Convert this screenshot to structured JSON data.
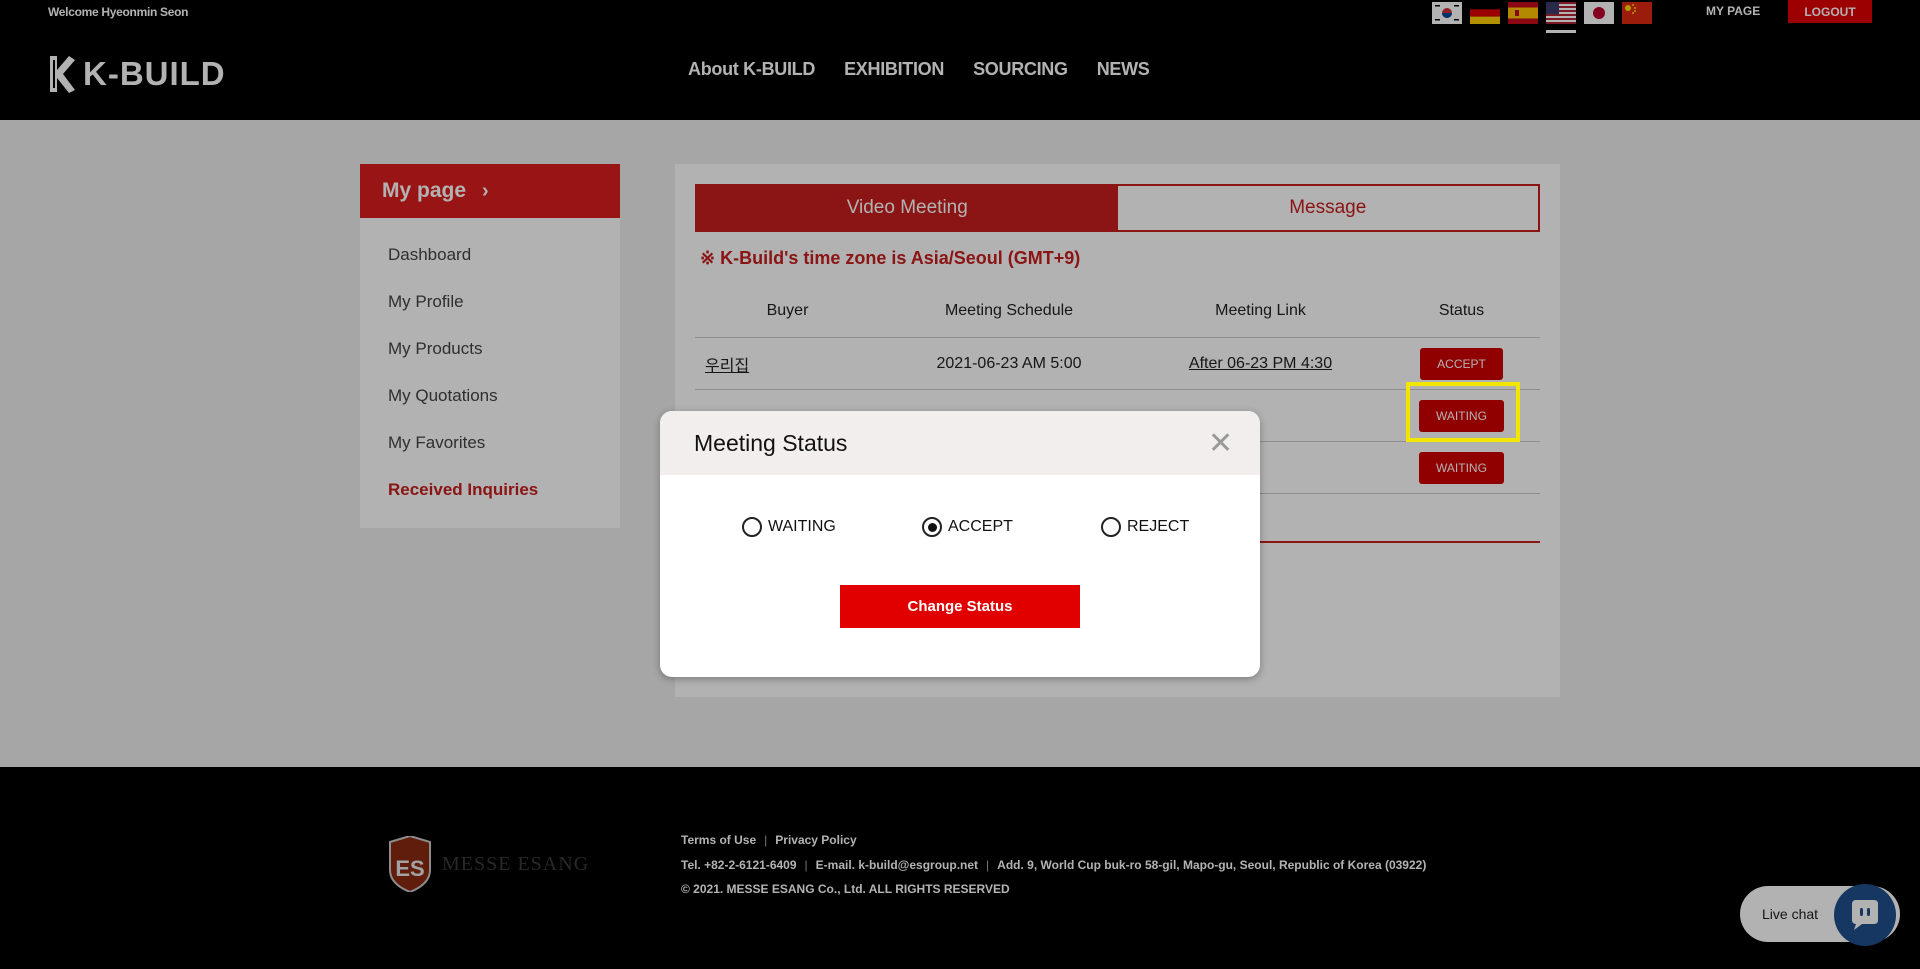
{
  "header": {
    "welcome": "Welcome Hyeonmin Seon",
    "logo_text": "K-BUILD",
    "nav": [
      "About K-BUILD",
      "EXHIBITION",
      "SOURCING",
      "NEWS"
    ],
    "my_page": "MY PAGE",
    "logout": "LOGOUT",
    "languages": [
      "korean-flag-icon",
      "german-flag-icon",
      "spanish-flag-icon",
      "us-flag-icon",
      "japanese-flag-icon",
      "chinese-flag-icon"
    ]
  },
  "sidebar": {
    "title": "My page",
    "items": [
      "Dashboard",
      "My Profile",
      "My Products",
      "My Quotations",
      "My Favorites",
      "Received Inquiries"
    ],
    "active": "Received Inquiries"
  },
  "main": {
    "tabs": [
      "Video Meeting",
      "Message"
    ],
    "active_tab": "Video Meeting",
    "timezone_note": "※ K-Build's time zone is Asia/Seoul (GMT+9)",
    "table": {
      "headers": [
        "Buyer",
        "Meeting Schedule",
        "Meeting Link",
        "Status"
      ],
      "rows": [
        {
          "buyer": "우리집",
          "schedule": "2021-06-23 AM 5:00",
          "link": "After 06-23 PM 4:30",
          "status": "ACCEPT"
        },
        {
          "buyer": "",
          "schedule": "",
          "link": "",
          "status": "WAITING"
        },
        {
          "buyer": "",
          "schedule": "",
          "link": "",
          "status": "WAITING"
        }
      ]
    }
  },
  "modal": {
    "title": "Meeting Status",
    "options": [
      "WAITING",
      "ACCEPT",
      "REJECT"
    ],
    "selected": "ACCEPT",
    "button": "Change Status"
  },
  "footer": {
    "brand": "MESSE ESANG",
    "links": [
      "Terms of Use",
      "Privacy Policy"
    ],
    "tel": "Tel. +82-2-6121-6409",
    "email": "E-mail. k-build@esgroup.net",
    "address": "Add. 9, World Cup buk-ro 58-gil, Mapo-gu, Seoul, Republic of Korea (03922)",
    "copyright": "© 2021. MESSE ESANG Co., Ltd. ALL RIGHTS RESERVED",
    "live_chat": "Live chat"
  },
  "colors": {
    "brand_red": "#c81e1e",
    "button_red": "#e00000",
    "highlight": "#f2e600",
    "chat_blue": "#1f4f8c"
  }
}
